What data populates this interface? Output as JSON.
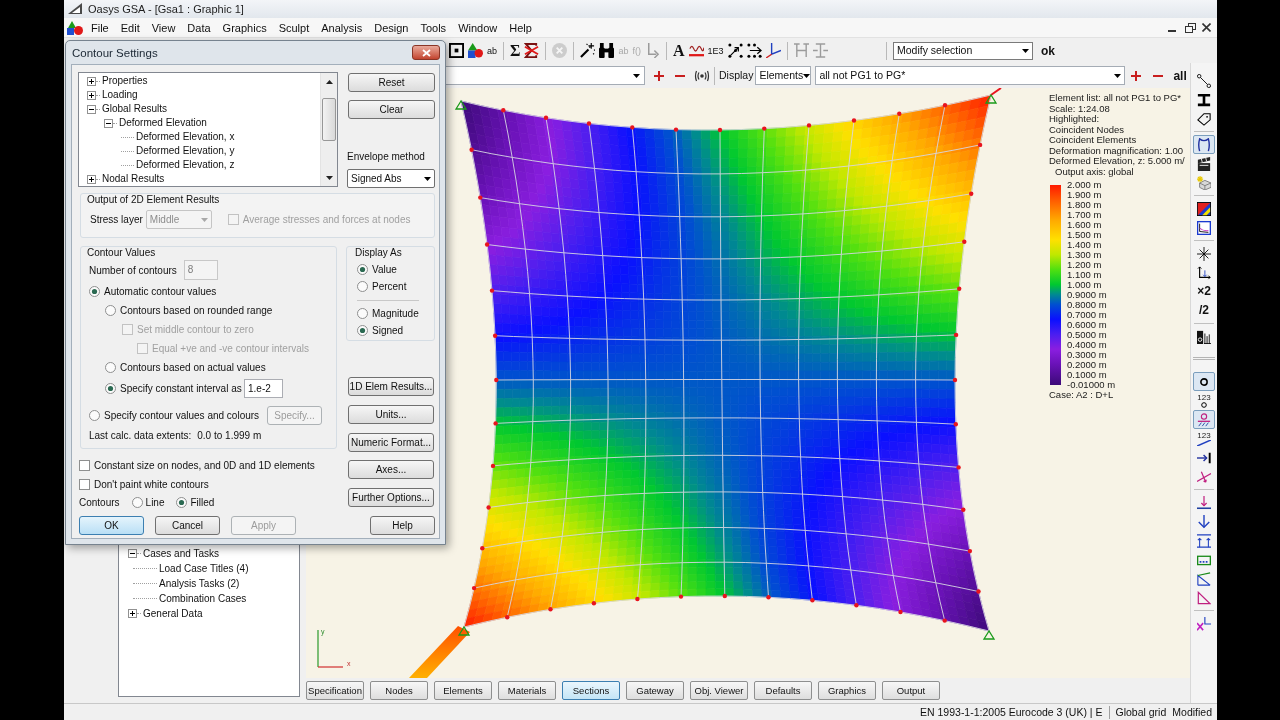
{
  "window": {
    "title": "Oasys GSA - [Gsa1 : Graphic 1]"
  },
  "menu": [
    "File",
    "Edit",
    "View",
    "Data",
    "Graphics",
    "Sculpt",
    "Analysis",
    "Design",
    "Tools",
    "Window",
    "Help"
  ],
  "toolbar": {
    "groups": [
      [
        {
          "kind": "icon",
          "disabled": false
        },
        {
          "kind": "icon",
          "disabled": false
        },
        {
          "kind": "text",
          "label": "ab",
          "disabled": false
        }
      ],
      [
        {
          "kind": "symbol",
          "label": "Σ",
          "disabled": false
        },
        {
          "kind": "icon",
          "disabled": false
        }
      ],
      [
        {
          "kind": "icon",
          "disabled": true
        }
      ],
      [
        {
          "kind": "icon",
          "disabled": false
        },
        {
          "kind": "icon",
          "disabled": false
        },
        {
          "kind": "text",
          "label": "ab",
          "disabled": true
        },
        {
          "kind": "text",
          "label": "f()",
          "disabled": true
        },
        {
          "kind": "icon",
          "disabled": true
        }
      ],
      [
        {
          "kind": "symbol",
          "label": "A",
          "disabled": false
        },
        {
          "kind": "icon",
          "disabled": false
        },
        {
          "kind": "text",
          "label": "1E3",
          "disabled": false
        },
        {
          "kind": "icon",
          "disabled": false
        },
        {
          "kind": "icon",
          "disabled": false
        },
        {
          "kind": "icon",
          "disabled": false
        }
      ],
      [
        {
          "kind": "icon",
          "disabled": true
        },
        {
          "kind": "icon",
          "disabled": true
        }
      ]
    ],
    "selection_mode": "Modify selection",
    "ok_button": "ok"
  },
  "filter_bar": {
    "display_label": "Display",
    "display_value": "Elements",
    "list_value": "all not PG1 to PG*",
    "all_button": "all"
  },
  "tree": [
    {
      "label": "Cases and Tasks",
      "expanded": true,
      "children": [
        {
          "label": "Load Case Titles (4)"
        },
        {
          "label": "Analysis Tasks (2)"
        },
        {
          "label": "Combination Cases"
        }
      ]
    },
    {
      "label": "General Data",
      "expanded": false
    }
  ],
  "canvas": {
    "legend": {
      "header": [
        "Element list: all not PG1 to PG*",
        "Scale: 1:24.08",
        "Highlighted:",
        "Coincident Nodes",
        "Coincident Elements",
        "Deformation magnification: 1.00",
        "Deformed Elevation, z: 5.000 m/"
      ],
      "axis_note": "Output axis: global",
      "scale": [
        "2.000 m",
        "1.900 m",
        "1.800 m",
        "1.700 m",
        "1.600 m",
        "1.500 m",
        "1.400 m",
        "1.300 m",
        "1.200 m",
        "1.100 m",
        "1.000 m",
        "0.9000 m",
        "0.8000 m",
        "0.7000 m",
        "0.6000 m",
        "0.5000 m",
        "0.4000 m",
        "0.3000 m",
        "0.2000 m",
        "0.1000 m",
        "-0.01000 m"
      ],
      "case": "Case: A2 : D+L"
    },
    "axes": {
      "y_label": "y",
      "x_label": "x"
    }
  },
  "tabs": [
    {
      "label": "Specification",
      "selected": false
    },
    {
      "label": "Nodes",
      "selected": false
    },
    {
      "label": "Elements",
      "selected": false
    },
    {
      "label": "Materials",
      "selected": false
    },
    {
      "label": "Sections",
      "selected": true
    },
    {
      "label": "Gateway",
      "selected": false
    },
    {
      "label": "Obj. Viewer",
      "selected": false
    },
    {
      "label": "Defaults",
      "selected": false
    },
    {
      "label": "Graphics",
      "selected": false
    },
    {
      "label": "Output",
      "selected": false
    }
  ],
  "right_toolbar": {
    "sections": [
      [
        [
          {
            "kind": "icon",
            "pressed": false
          },
          {
            "kind": "icon",
            "pressed": false
          },
          {
            "kind": "icon",
            "pressed": false
          }
        ],
        [
          {
            "kind": "icon",
            "pressed": true
          },
          {
            "kind": "icon",
            "pressed": false
          },
          {
            "kind": "icon",
            "pressed": false
          }
        ],
        [
          {
            "kind": "icon",
            "pressed": false
          },
          {
            "kind": "icon",
            "pressed": false
          }
        ],
        [
          {
            "kind": "icon",
            "pressed": false
          },
          {
            "kind": "icon",
            "pressed": false
          },
          {
            "kind": "text",
            "label": "×2",
            "pressed": false
          },
          {
            "kind": "text",
            "label": "/2",
            "pressed": false
          }
        ],
        [
          {
            "kind": "icon",
            "pressed": false
          }
        ]
      ],
      [
        [
          {
            "kind": "icon",
            "pressed": true
          },
          {
            "kind": "captioned",
            "caption": "123",
            "pressed": false
          },
          {
            "kind": "icon",
            "pressed": true
          },
          {
            "kind": "captioned",
            "caption": "123",
            "pressed": false
          },
          {
            "kind": "icon",
            "pressed": false
          },
          {
            "kind": "icon",
            "pressed": false
          }
        ],
        [
          {
            "kind": "icon",
            "pressed": false
          },
          {
            "kind": "icon",
            "pressed": false
          },
          {
            "kind": "icon",
            "pressed": false
          },
          {
            "kind": "icon",
            "pressed": false
          },
          {
            "kind": "icon",
            "pressed": false
          },
          {
            "kind": "icon",
            "pressed": false
          }
        ],
        [
          {
            "kind": "icon",
            "pressed": false
          }
        ]
      ]
    ]
  },
  "status_bar": [
    "EN 1993-1-1:2005 Eurocode 3 (UK) | E",
    "Global grid",
    "Modified"
  ],
  "dialog": {
    "title": "Contour Settings",
    "tree": [
      {
        "label": "Properties",
        "expanded": false
      },
      {
        "label": "Loading",
        "expanded": false
      },
      {
        "label": "Global Results",
        "expanded": true,
        "children": [
          {
            "label": "Deformed Elevation",
            "expanded": true,
            "children": [
              {
                "label": "Deformed Elevation, x"
              },
              {
                "label": "Deformed Elevation, y"
              },
              {
                "label": "Deformed Elevation, z"
              }
            ]
          }
        ]
      },
      {
        "label": "Nodal Results",
        "expanded": false
      }
    ],
    "side_buttons": [
      "Reset",
      "Clear"
    ],
    "envelope": {
      "label": "Envelope method",
      "value": "Signed Abs"
    },
    "output_2d": {
      "title": "Output of 2D Element Results",
      "stress_layer": {
        "label": "Stress layer",
        "value": "Middle",
        "disabled": true
      },
      "average": {
        "label": "Average stresses and forces at nodes",
        "checked": false,
        "disabled": true
      }
    },
    "contour_values": {
      "title": "Contour Values",
      "count": {
        "label": "Number of contours",
        "value": "8",
        "disabled": true
      },
      "options": [
        {
          "kind": "radio",
          "label": "Automatic contour values",
          "selected": true,
          "disabled": false,
          "children": [
            {
              "kind": "radio",
              "label": "Contours based on rounded range",
              "selected": false,
              "disabled": false,
              "children": [
                {
                  "kind": "checkbox",
                  "label": "Set middle contour to zero",
                  "checked": false,
                  "disabled": true,
                  "children": [
                    {
                      "kind": "checkbox",
                      "label": "Equal +ve and -ve contour intervals",
                      "checked": false,
                      "disabled": true
                    }
                  ]
                }
              ]
            },
            {
              "kind": "radio",
              "label": "Contours based on actual values",
              "selected": false,
              "disabled": false
            },
            {
              "kind": "radio",
              "label": "Specify constant interval as",
              "selected": true,
              "disabled": false,
              "value": "1.e-2"
            }
          ]
        },
        {
          "kind": "radio",
          "label": "Specify contour values and colours",
          "selected": false,
          "disabled": false,
          "button": {
            "label": "Specify...",
            "disabled": true
          }
        }
      ],
      "extents_label": "Last calc. data extents:",
      "extents_value": "0.0 to 1.999 m"
    },
    "display_as": {
      "title": "Display As",
      "groups": [
        [
          {
            "label": "Value",
            "selected": true
          },
          {
            "label": "Percent",
            "selected": false
          }
        ],
        [
          {
            "label": "Magnitude",
            "selected": false
          },
          {
            "label": "Signed",
            "selected": true
          }
        ]
      ]
    },
    "more_buttons": [
      "1D Elem Results...",
      "Units...",
      "Numeric Format...",
      "Axes...",
      "Further Options..."
    ],
    "checkboxes": [
      {
        "label": "Constant size on nodes, and 0D and 1D elements",
        "checked": false
      },
      {
        "label": "Don't paint white contours",
        "checked": false
      }
    ],
    "contours": {
      "label": "Contours",
      "options": [
        {
          "label": "Line",
          "selected": false
        },
        {
          "label": "Filled",
          "selected": true
        }
      ]
    },
    "buttons": [
      {
        "label": "OK",
        "default": true,
        "disabled": false
      },
      {
        "label": "Cancel",
        "default": false,
        "disabled": false
      },
      {
        "label": "Apply",
        "default": false,
        "disabled": true
      }
    ],
    "help_button": "Help"
  }
}
